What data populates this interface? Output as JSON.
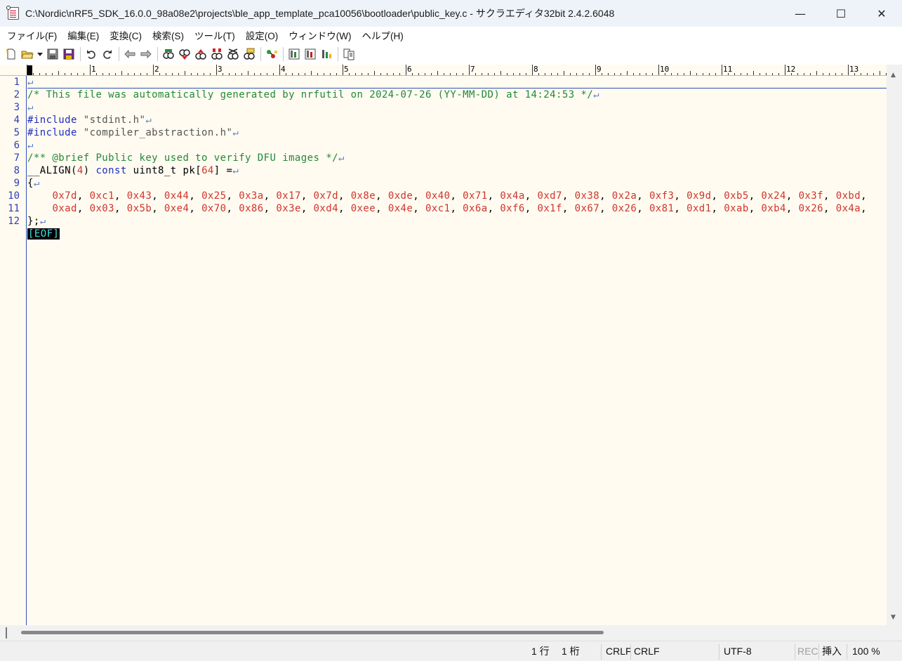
{
  "window": {
    "title": "C:\\Nordic\\nRF5_SDK_16.0.0_98a08e2\\projects\\ble_app_template_pca10056\\bootloader\\public_key.c - サクラエディタ32bit 2.4.2.6048",
    "minimize": "—",
    "maximize": "☐",
    "close": "✕"
  },
  "menu": {
    "items": [
      "ファイル(F)",
      "編集(E)",
      "変換(C)",
      "検索(S)",
      "ツール(T)",
      "設定(O)",
      "ウィンドウ(W)",
      "ヘルプ(H)"
    ]
  },
  "toolbar": {
    "icons": [
      "new-file-icon",
      "open-file-icon",
      "dropdown-arrow-icon",
      "save-icon",
      "save-all-icon",
      "undo-icon",
      "redo-icon",
      "back-icon",
      "forward-icon",
      "search-icon",
      "search-down-icon",
      "search-up-icon",
      "search-marker-icon",
      "replace-icon",
      "search-clear-icon",
      "tag-jump-icon",
      "grep-icon",
      "grep-replace-icon",
      "outline-icon",
      "compare-icon"
    ]
  },
  "ruler": {
    "labels": [
      "0",
      "1",
      "2",
      "3",
      "4",
      "5",
      "6",
      "7",
      "8",
      "9",
      "10",
      "11",
      "12",
      "13"
    ]
  },
  "editor": {
    "line_numbers": [
      "1",
      "2",
      "3",
      "4",
      "5",
      "6",
      "7",
      "8",
      "9",
      "10",
      "11",
      "12"
    ],
    "line2_comment": "/* This file was automatically generated by nrfutil on 2024-07-26 (YY-MM-DD) at 14:24:53 */",
    "line4_directive": "#include ",
    "line4_string": "\"stdint.h\"",
    "line5_directive": "#include ",
    "line5_string": "\"compiler_abstraction.h\"",
    "line7_comment": "/** @brief Public key used to verify DFU images */",
    "line8_pre": "__ALIGN(",
    "line8_num1": "4",
    "line8_mid": ") ",
    "line8_kw": "const",
    "line8_mid2": " uint8_t pk[",
    "line8_num2": "64",
    "line8_post": "] =",
    "line9": "{",
    "line10_bytes": [
      "0x7d",
      "0xc1",
      "0x43",
      "0x44",
      "0x25",
      "0x3a",
      "0x17",
      "0x7d",
      "0x8e",
      "0xde",
      "0x40",
      "0x71",
      "0x4a",
      "0xd7",
      "0x38",
      "0x2a",
      "0xf3",
      "0x9d",
      "0xb5",
      "0x24",
      "0x3f",
      "0xbd"
    ],
    "line11_bytes": [
      "0xad",
      "0x03",
      "0x5b",
      "0xe4",
      "0x70",
      "0x86",
      "0x3e",
      "0xd4",
      "0xee",
      "0x4e",
      "0xc1",
      "0x6a",
      "0xf6",
      "0x1f",
      "0x67",
      "0x26",
      "0x81",
      "0xd1",
      "0xab",
      "0xb4",
      "0x26",
      "0x4a"
    ],
    "line12": "};",
    "cr_mark": "↵",
    "eof_mark": "[EOF]"
  },
  "status": {
    "line": "1 行",
    "column": "1 桁",
    "eol1": "CRLF",
    "eol2": "CRLF",
    "encoding": "UTF-8",
    "rec": "REC",
    "mode": "挿入",
    "zoom": "100 %"
  },
  "colors": {
    "editor_bg": "#fffbf0",
    "line_number": "#2f3fb8",
    "comment": "#22883a",
    "number": "#d0342c",
    "keyword": "#1f2cc0",
    "eof_fg": "#3ee0e8"
  }
}
